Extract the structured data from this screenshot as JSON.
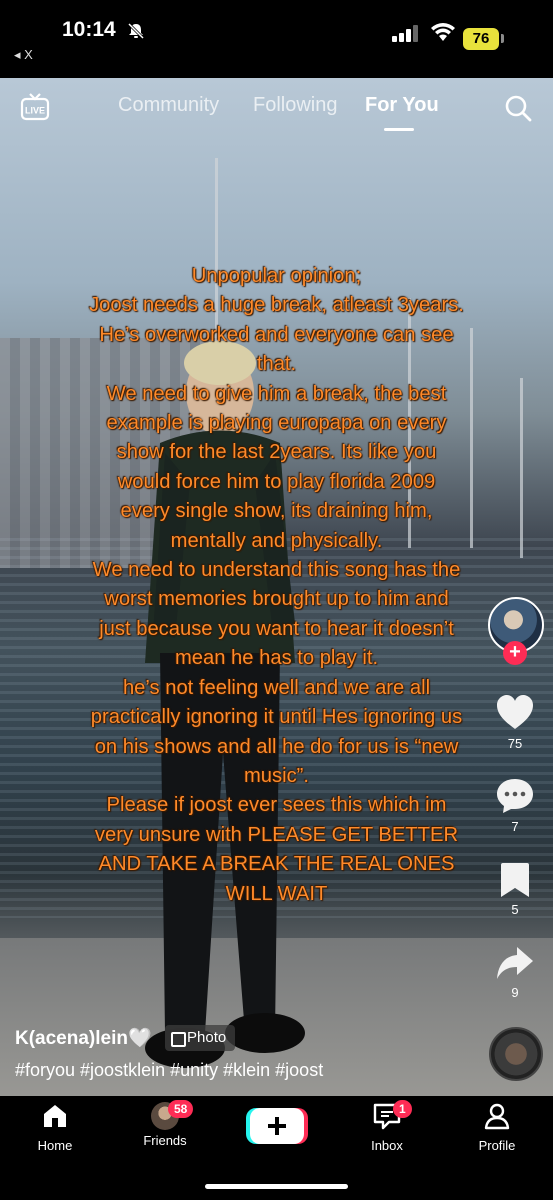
{
  "status_bar": {
    "time": "10:14",
    "back_app": "◂ X",
    "battery": "76",
    "icons": [
      "bell-slash-icon",
      "signal-icon",
      "wifi-icon",
      "battery-icon"
    ]
  },
  "top_nav": {
    "live_label": "LIVE",
    "tabs": [
      {
        "label": "Community"
      },
      {
        "label": "Following"
      },
      {
        "label": "For You",
        "active": true
      }
    ],
    "icons": [
      "live-icon",
      "search-icon"
    ]
  },
  "post": {
    "overlay_text_lines": [
      "Unpopular opinion;",
      "Joost needs a huge break, atleast 3years.",
      "He’s overworked and everyone can see",
      "that.",
      "We need to give him a break, the best",
      "example is playing europapa on every",
      "show for the last 2years. Its like you",
      "would force him to play florida 2009",
      "every single show, its draining him,",
      "mentally and physically.",
      "We need to understand this song has the",
      "worst memories brought up to him and",
      "just because you want to hear it doesn’t",
      "mean he has to play it.",
      "he’s not feeling well and we are all",
      "practically ignoring it until Hes ignoring us",
      "on his shows and all he do for us is “new",
      "music”.",
      "Please if joost ever sees this which im",
      "very unsure with  PLEASE GET BETTER",
      "AND TAKE A BREAK THE REAL ONES",
      "WILL WAIT"
    ],
    "username": "K(acena)lein🤍",
    "photo_badge": "Photo",
    "hashtags": "#foryou #joostklein #unity #klein #joost"
  },
  "right_rail": {
    "likes": "75",
    "comments": "7",
    "saves": "5",
    "shares": "9",
    "follow_plus": "+",
    "icons": [
      "heart-icon",
      "comment-icon",
      "bookmark-icon",
      "share-icon"
    ]
  },
  "bottom_nav": {
    "items": [
      {
        "label": "Home",
        "icon": "home-icon"
      },
      {
        "label": "Friends",
        "icon": "friends-avatar",
        "badge": "58"
      },
      {
        "label": "",
        "icon": "create-plus-icon"
      },
      {
        "label": "Inbox",
        "icon": "inbox-icon",
        "badge": "1"
      },
      {
        "label": "Profile",
        "icon": "profile-icon"
      }
    ]
  },
  "colors": {
    "accent": "#fe2c55",
    "overlay_text": "#ff8a2a",
    "battery": "#e8e23c"
  }
}
